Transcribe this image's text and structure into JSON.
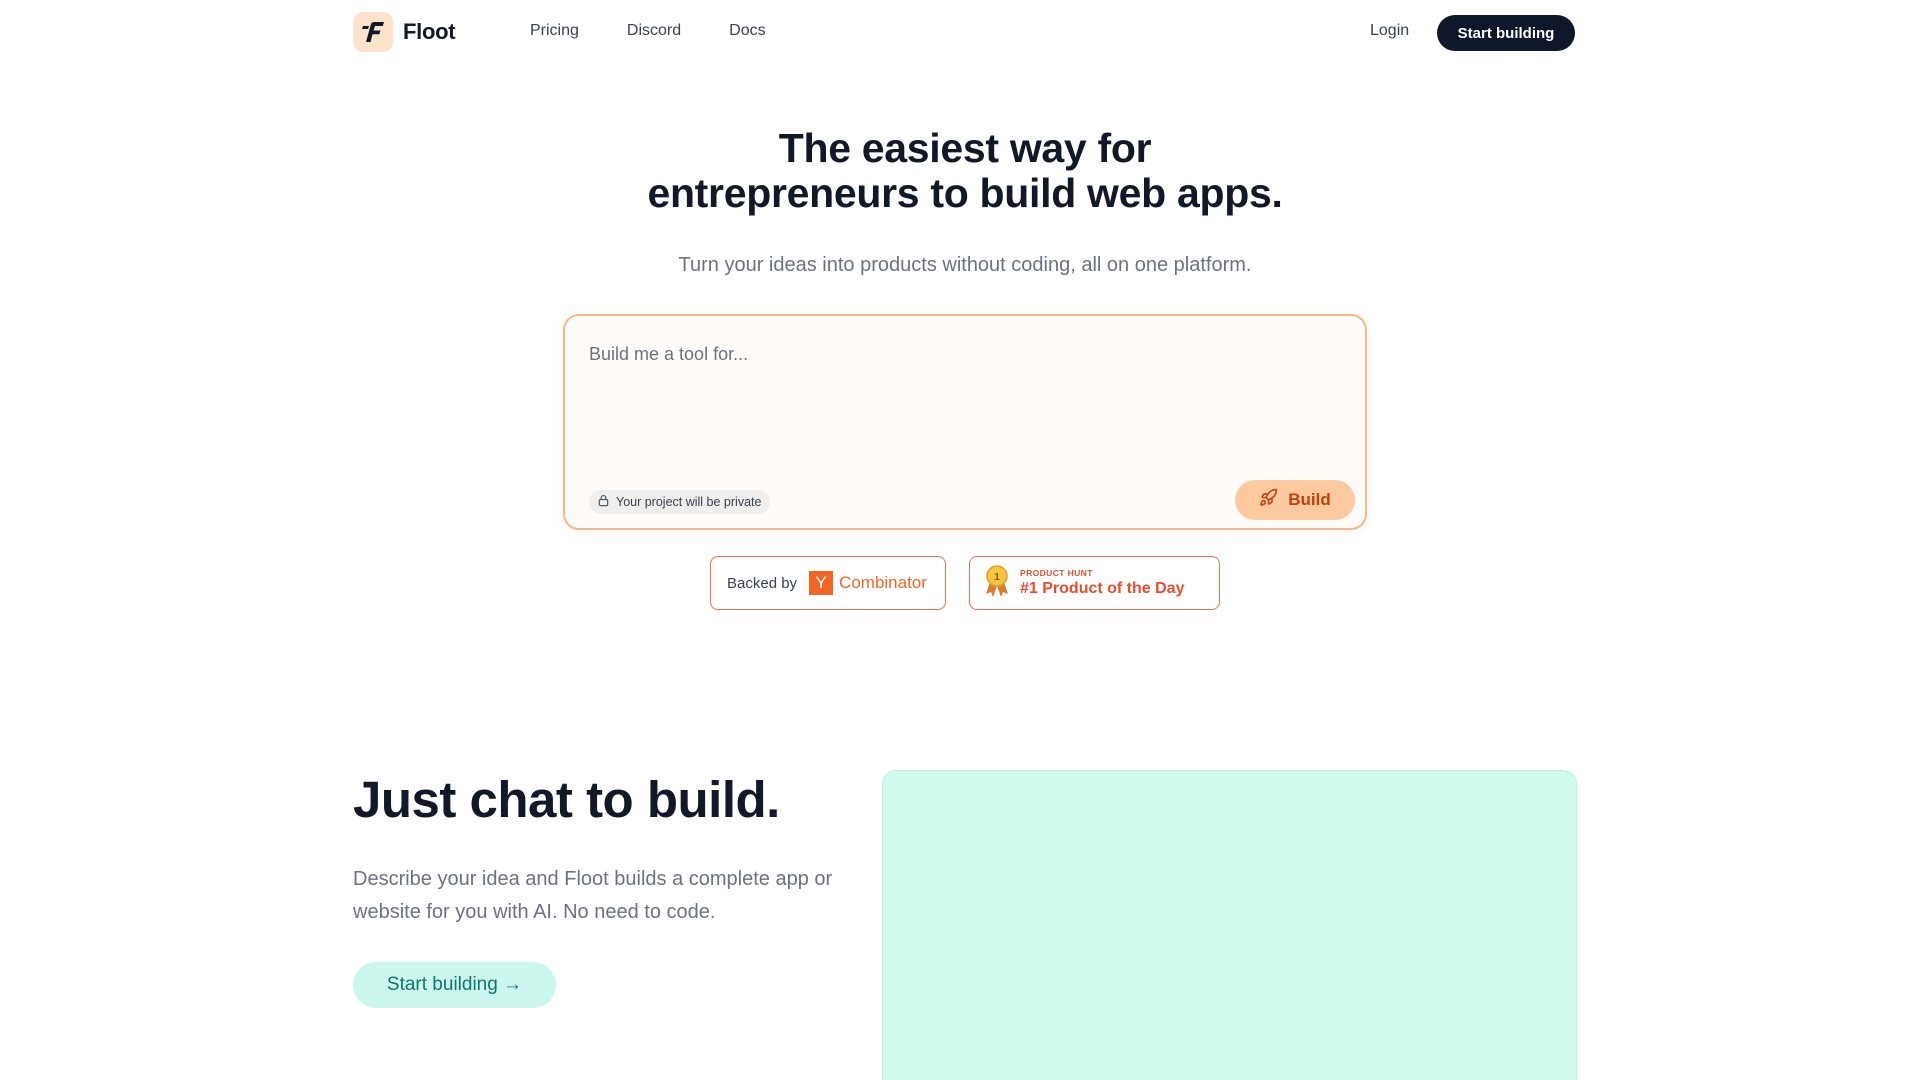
{
  "header": {
    "logo_text": "Floot",
    "nav": [
      {
        "label": "Pricing"
      },
      {
        "label": "Discord"
      },
      {
        "label": "Docs"
      }
    ],
    "login_label": "Login",
    "start_label": "Start building"
  },
  "hero": {
    "title_line1": "The easiest way for",
    "title_line2": "entrepreneurs to build web apps.",
    "subtitle": "Turn your ideas into products without coding, all on one platform.",
    "prompt_placeholder": "Build me a tool for...",
    "privacy_label": "Your project will be private",
    "build_label": "Build"
  },
  "badges": {
    "backed_by": "Backed by",
    "yc_letter": "Y",
    "yc_word": "Combinator",
    "ph_small": "PRODUCT HUNT",
    "ph_big": "#1 Product of the Day",
    "ph_medal_number": "1"
  },
  "section_chat": {
    "title": "Just chat to build.",
    "description": "Describe your idea and Floot builds a complete app or website for you with AI. No need to code.",
    "button_label": "Start building →"
  },
  "colors": {
    "primary_dark": "#0f172a",
    "accent_orange": "#f26522",
    "accent_peach": "#fdcaa0",
    "accent_teal": "#ccf7ee"
  },
  "icons": [
    "floot-logo-icon",
    "lock-icon",
    "rocket-icon",
    "product-hunt-medal-icon"
  ]
}
